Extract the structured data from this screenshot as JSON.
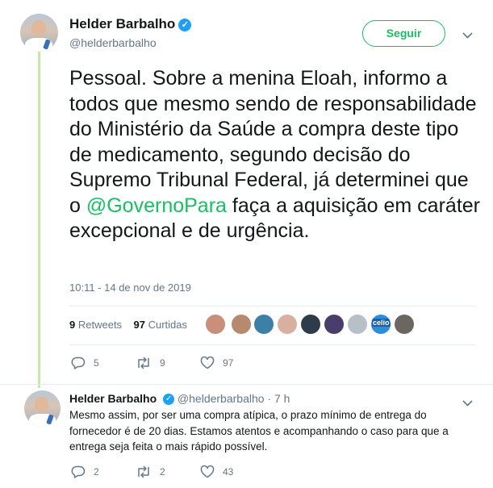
{
  "main_tweet": {
    "author_name": "Helder Barbalho",
    "author_handle": "@helderbarbalho",
    "follow_label": "Seguir",
    "text_before": "Pessoal. Sobre a menina Eloah,  informo a todos que mesmo sendo de responsabilidade do Ministério da Saúde a compra deste tipo de medicamento, segundo decisão do Supremo Tribunal Federal, já determinei que o ",
    "mention": "@GovernoPara",
    "text_after": " faça a aquisição em caráter excepcional e de urgência.",
    "timestamp": "10:11 - 14 de nov de 2019",
    "retweets_count": "9",
    "retweets_label": "Retweets",
    "likes_count": "97",
    "likes_label": "Curtidas",
    "likers": [
      "#c98f7a",
      "#b58a6e",
      "#3d7fa6",
      "#d8b0a0",
      "#2e3b4a",
      "#4a3d6b",
      "#b7c0c9",
      "#2a8fd8",
      "#6b6660"
    ],
    "liker_badge": "celio",
    "actions": {
      "replies": "5",
      "retweets": "9",
      "likes": "97"
    }
  },
  "reply_tweet": {
    "author_name": "Helder Barbalho",
    "author_handle": "@helderbarbalho",
    "time": "· 7 h",
    "text": "Mesmo assim, por ser uma compra atípica, o prazo mínimo de entrega do fornecedor é de 20 dias. Estamos atentos e acompanhando o caso para que a entrega seja feita o mais rápido possível.",
    "actions": {
      "replies": "2",
      "retweets": "2",
      "likes": "43"
    }
  },
  "colors": {
    "accent": "#17bf63",
    "verified": "#1da1f2",
    "thread_line": "#c4eaa9",
    "muted": "#657786"
  }
}
